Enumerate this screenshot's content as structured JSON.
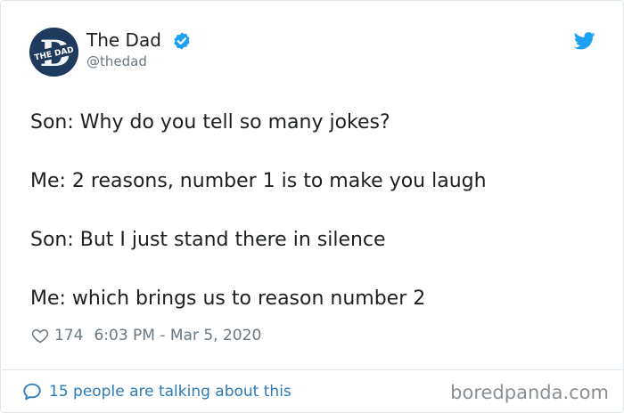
{
  "author": {
    "name": "The Dad",
    "handle": "@thedad",
    "avatar_text": "THE DAD",
    "verified": true
  },
  "icons": {
    "verified": "verified-badge-icon",
    "platform": "twitter-bird-icon",
    "like": "heart-icon",
    "reply": "speech-bubble-icon"
  },
  "tweet": {
    "lines": [
      "Son: Why do you tell so many jokes?",
      "Me: 2 reasons, number 1 is to make you laugh",
      "Son: But I just stand there in silence",
      "Me: which brings us to reason number 2"
    ]
  },
  "meta": {
    "likes": "174",
    "timestamp": "6:03 PM - Mar 5, 2020"
  },
  "footer": {
    "conversation_text": "15 people are talking about this",
    "watermark": "boredpanda.com"
  },
  "colors": {
    "twitter_blue": "#1da1f2",
    "link_blue": "#2b7bb9",
    "muted": "#697882",
    "text": "#1c2022",
    "avatar_bg": "#1f3a5f"
  }
}
